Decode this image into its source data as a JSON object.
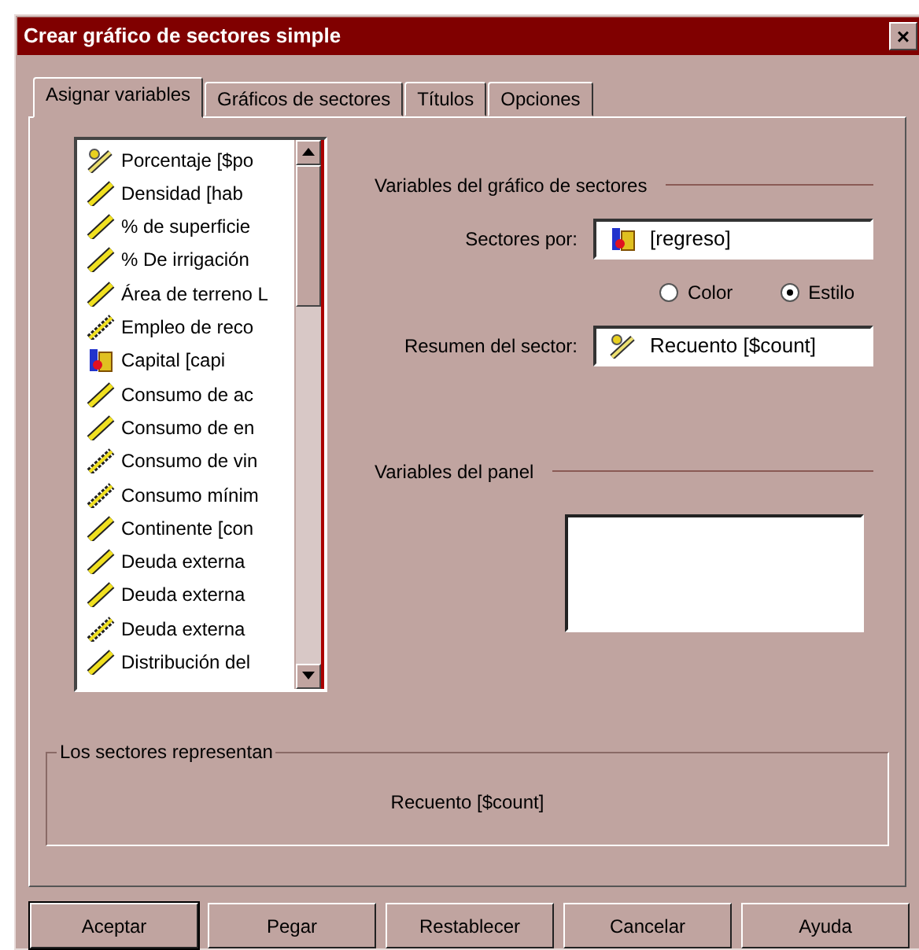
{
  "window": {
    "title": "Crear gráfico de sectores simple",
    "close": "×"
  },
  "tabs": [
    {
      "label": "Asignar variables",
      "selected": true
    },
    {
      "label": "Gráficos de sectores",
      "selected": false
    },
    {
      "label": "Títulos",
      "selected": false
    },
    {
      "label": "Opciones",
      "selected": false
    }
  ],
  "variables": [
    {
      "label": "Porcentaje [$po",
      "kind": "summary"
    },
    {
      "label": "Densidad [hab",
      "kind": "scale"
    },
    {
      "label": "% de superficie",
      "kind": "scale"
    },
    {
      "label": "% De irrigación",
      "kind": "scale"
    },
    {
      "label": "Área de terreno L",
      "kind": "scale"
    },
    {
      "label": "Empleo de reco",
      "kind": "ordinal"
    },
    {
      "label": "Capital [capi",
      "kind": "nominal"
    },
    {
      "label": "Consumo de ac",
      "kind": "scale"
    },
    {
      "label": "Consumo de en",
      "kind": "scale"
    },
    {
      "label": "Consumo de vin",
      "kind": "ordinal"
    },
    {
      "label": "Consumo mínim",
      "kind": "ordinal"
    },
    {
      "label": "Continente [con",
      "kind": "scale"
    },
    {
      "label": "Deuda externa",
      "kind": "scale"
    },
    {
      "label": "Deuda externa",
      "kind": "scale"
    },
    {
      "label": "Deuda externa",
      "kind": "ordinal"
    },
    {
      "label": "Distribución del",
      "kind": "scale"
    }
  ],
  "chart_variables": {
    "heading": "Variables del gráfico de sectores",
    "slice_by": {
      "label": "Sectores por:",
      "value": "[regreso]"
    },
    "radios": [
      {
        "label": "Color",
        "selected": false
      },
      {
        "label": "Estilo",
        "selected": true
      }
    ],
    "summary": {
      "label": "Resumen del sector:",
      "value": "Recuento [$count]"
    }
  },
  "panel_variables": {
    "heading": "Variables del panel"
  },
  "slices_represent": {
    "heading": "Los sectores representan",
    "value": "Recuento [$count]"
  },
  "buttons": [
    "Aceptar",
    "Pegar",
    "Restablecer",
    "Cancelar",
    "Ayuda"
  ]
}
